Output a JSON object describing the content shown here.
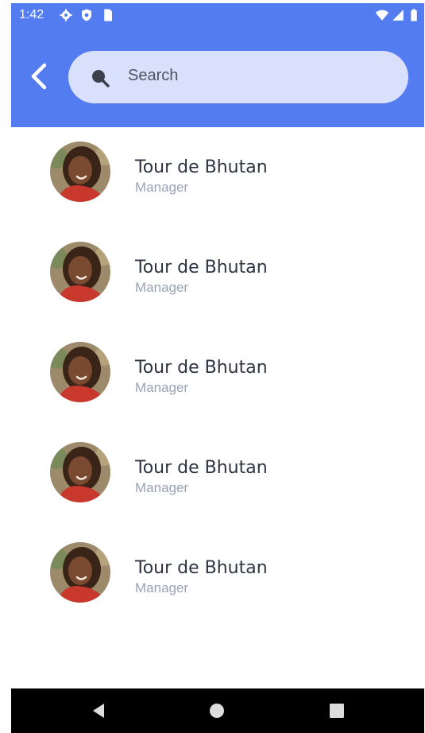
{
  "status_bar": {
    "time": "1:42",
    "left_icons": [
      "gear-icon",
      "shield-icon",
      "sim-card-icon"
    ],
    "right_icons": [
      "wifi-icon",
      "cellular-signal-icon",
      "battery-icon"
    ]
  },
  "header": {
    "back_icon": "chevron-left-icon",
    "search": {
      "icon": "search-icon",
      "placeholder": "Search"
    }
  },
  "people": [
    {
      "name": "Tour de Bhutan",
      "role": "Manager"
    },
    {
      "name": "Tour de Bhutan",
      "role": "Manager"
    },
    {
      "name": "Tour de Bhutan",
      "role": "Manager"
    },
    {
      "name": "Tour de Bhutan",
      "role": "Manager"
    },
    {
      "name": "Tour de Bhutan",
      "role": "Manager"
    }
  ],
  "nav_bar": {
    "buttons": [
      "back-triangle-icon",
      "home-circle-icon",
      "recents-square-icon"
    ]
  },
  "colors": {
    "header": "#537cf0",
    "search_box": "#d9e0fb",
    "name_text": "#2d3340",
    "role_text": "#9aa3b4",
    "nav_bar": "#000000"
  }
}
